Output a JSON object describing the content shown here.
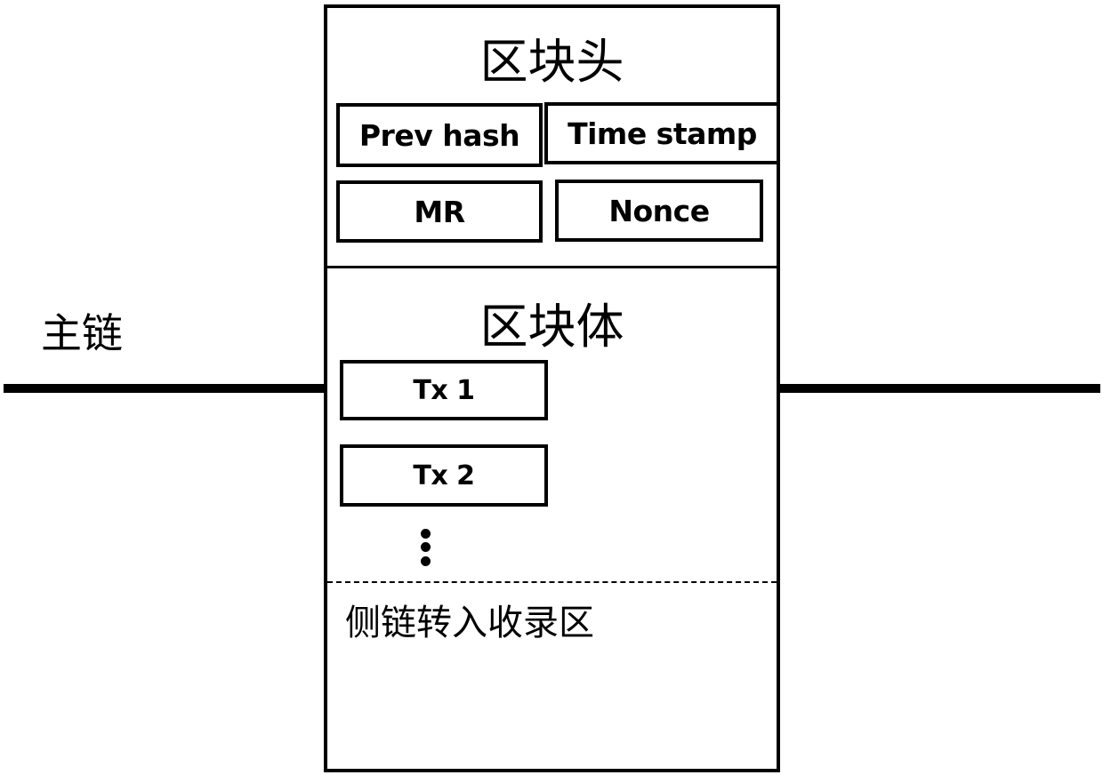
{
  "main_chain": {
    "label": "主链"
  },
  "block": {
    "header": {
      "title": "区块头",
      "fields": [
        {
          "label": "Prev hash"
        },
        {
          "label": "Time stamp"
        },
        {
          "label": "MR"
        },
        {
          "label": "Nonce"
        }
      ]
    },
    "body": {
      "title": "区块体",
      "transactions": [
        {
          "label": "Tx 1"
        },
        {
          "label": "Tx 2"
        }
      ],
      "ellipsis": "⋮",
      "sidechain_zone": {
        "label": "侧链转入收录区"
      }
    }
  }
}
